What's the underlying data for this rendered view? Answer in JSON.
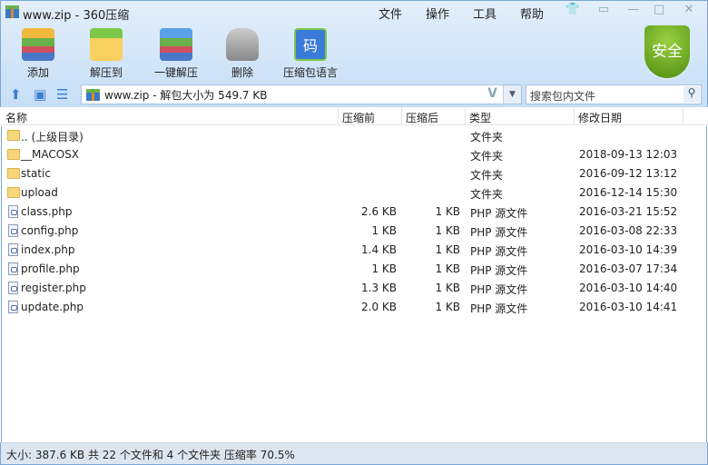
{
  "window": {
    "title": "www.zip - 360压缩"
  },
  "menu": [
    "文件",
    "操作",
    "工具",
    "帮助"
  ],
  "toolbar": [
    {
      "label": "添加",
      "icon": "add-icon"
    },
    {
      "label": "解压到",
      "icon": "extract-to-icon"
    },
    {
      "label": "一键解压",
      "icon": "one-click-extract-icon"
    },
    {
      "label": "删除",
      "icon": "delete-icon"
    },
    {
      "label": "压缩包语言",
      "icon": "language-icon",
      "glyph": "码"
    }
  ],
  "security": {
    "label": "安全",
    "color": "#6aa820"
  },
  "address": {
    "value": "www.zip - 解包大小为 549.7 KB"
  },
  "search": {
    "placeholder": "搜索包内文件"
  },
  "columns": [
    "名称",
    "压缩前",
    "压缩后",
    "类型",
    "修改日期"
  ],
  "files": [
    {
      "name": ".. (上级目录)",
      "kind": "folder",
      "before": "",
      "after": "",
      "type": "文件夹",
      "date": ""
    },
    {
      "name": "__MACOSX",
      "kind": "folder",
      "before": "",
      "after": "",
      "type": "文件夹",
      "date": "2018-09-13 12:03"
    },
    {
      "name": "static",
      "kind": "folder",
      "before": "",
      "after": "",
      "type": "文件夹",
      "date": "2016-09-12 13:12"
    },
    {
      "name": "upload",
      "kind": "folder",
      "before": "",
      "after": "",
      "type": "文件夹",
      "date": "2016-12-14 15:30"
    },
    {
      "name": "class.php",
      "kind": "php",
      "before": "2.6 KB",
      "after": "1 KB",
      "type": "PHP 源文件",
      "date": "2016-03-21 15:52"
    },
    {
      "name": "config.php",
      "kind": "php",
      "before": "1 KB",
      "after": "1 KB",
      "type": "PHP 源文件",
      "date": "2016-03-08 22:33"
    },
    {
      "name": "index.php",
      "kind": "php",
      "before": "1.4 KB",
      "after": "1 KB",
      "type": "PHP 源文件",
      "date": "2016-03-10 14:39"
    },
    {
      "name": "profile.php",
      "kind": "php",
      "before": "1 KB",
      "after": "1 KB",
      "type": "PHP 源文件",
      "date": "2016-03-07 17:34"
    },
    {
      "name": "register.php",
      "kind": "php",
      "before": "1.3 KB",
      "after": "1 KB",
      "type": "PHP 源文件",
      "date": "2016-03-10 14:40"
    },
    {
      "name": "update.php",
      "kind": "php",
      "before": "2.0 KB",
      "after": "1 KB",
      "type": "PHP 源文件",
      "date": "2016-03-10 14:41"
    }
  ],
  "status": "大小: 387.6 KB 共 22 个文件和 4 个文件夹 压缩率 70.5%"
}
